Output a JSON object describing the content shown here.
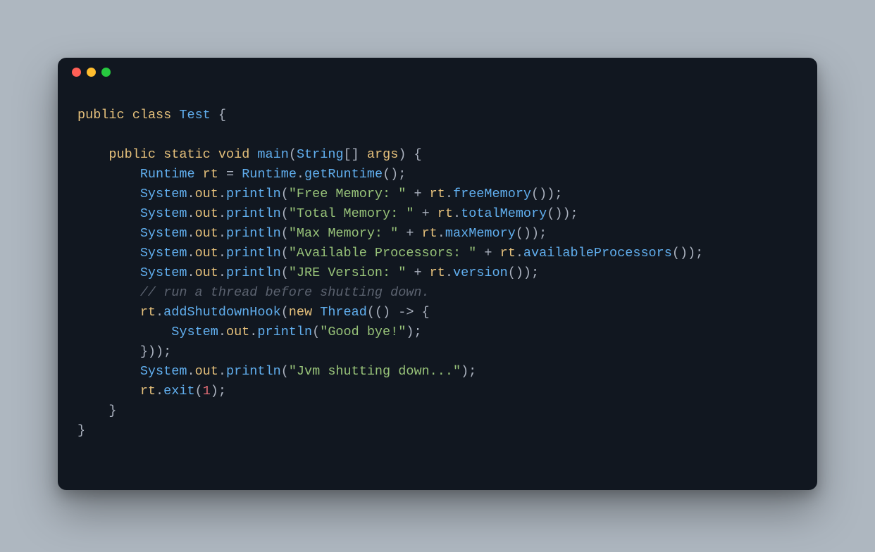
{
  "colors": {
    "background": "#aeb7c0",
    "editor_bg": "#111720",
    "dot_red": "#ff5f56",
    "dot_yellow": "#ffbd2e",
    "dot_green": "#27c93f",
    "keyword": "#e5c07b",
    "type": "#61afef",
    "identifier": "#e5c07b",
    "string": "#98c379",
    "number": "#e06c75",
    "comment": "#5c6370",
    "default": "#abb2bf"
  },
  "code": {
    "language": "java",
    "class_name": "Test",
    "method_name": "main",
    "param_type": "String",
    "param_name": "args",
    "strings": {
      "free_memory": "\"Free Memory: \"",
      "total_memory": "\"Total Memory: \"",
      "max_memory": "\"Max Memory: \"",
      "available_processors": "\"Available Processors: \"",
      "jre_version": "\"JRE Version: \"",
      "good_bye": "\"Good bye!\"",
      "shutting_down": "\"Jvm shutting down...\""
    },
    "comment": "// run a thread before shutting down.",
    "exit_code": "1",
    "kw": {
      "public": "public",
      "class": "class",
      "static": "static",
      "void": "void",
      "new": "new"
    },
    "types": {
      "Runtime": "Runtime",
      "System": "System",
      "Thread": "Thread"
    },
    "ids": {
      "rt": "rt",
      "out": "out"
    },
    "methods": {
      "getRuntime": "getRuntime",
      "println": "println",
      "freeMemory": "freeMemory",
      "totalMemory": "totalMemory",
      "maxMemory": "maxMemory",
      "availableProcessors": "availableProcessors",
      "version": "version",
      "addShutdownHook": "addShutdownHook",
      "exit": "exit"
    }
  }
}
